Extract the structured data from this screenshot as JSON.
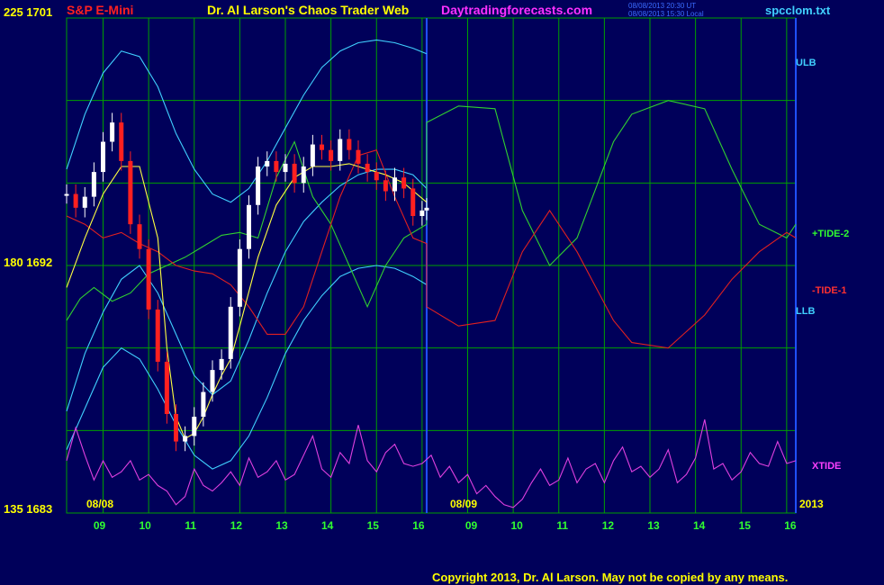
{
  "header": {
    "instrument": "S&P E-Mini",
    "title": "Dr. Al Larson's Chaos Trader Web",
    "site": "Daytradingforecasts.com",
    "stamp_line1": "08/08/2013 20:30 UT",
    "stamp_line2": "08/08/2013 15:30 Local",
    "file": "spcclom.txt"
  },
  "copyright": "Copyright 2013, Dr. Al Larson. May not be copied by any means.",
  "y_axis_labels": [
    "225 1701",
    "180 1692",
    "135 1683"
  ],
  "x_axis_labels": {
    "left_date": "08/08",
    "mid_date": "08/09",
    "year": "2013",
    "hours_day1": [
      "09",
      "10",
      "11",
      "12",
      "13",
      "14",
      "15",
      "16"
    ],
    "hours_day2": [
      "09",
      "10",
      "11",
      "12",
      "13",
      "14",
      "15",
      "16"
    ]
  },
  "series_labels": {
    "ulb": "ULB",
    "tide2": "+TIDE-2",
    "tide1": "-TIDE-1",
    "llb": "LLB",
    "xtide": "XTIDE"
  },
  "colors": {
    "background": "#00005a",
    "grid": "#00a000",
    "divider": "#2050ff",
    "price_up": "#ffffff",
    "price_down": "#ff2020",
    "band": "#40d0ff",
    "tide2": "#30d030",
    "tide1": "#e02020",
    "xtide": "#e040e0",
    "avg": "#ffff40"
  },
  "chart_data": {
    "type": "line",
    "y_left_range": [
      135,
      225
    ],
    "y_right_range": [
      1683,
      1701
    ],
    "x_range_hours": [
      8.2,
      24.2
    ],
    "divider_hour": 16.1,
    "series": [
      {
        "name": "ULB",
        "x": [
          8.2,
          8.6,
          9.0,
          9.4,
          9.8,
          10.2,
          10.6,
          11.0,
          11.4,
          11.8,
          12.2,
          12.6,
          13.0,
          13.4,
          13.8,
          14.2,
          14.6,
          15.0,
          15.4,
          15.8,
          16.1
        ],
        "y": [
          1695.5,
          1697.5,
          1699.0,
          1699.8,
          1699.6,
          1698.5,
          1696.8,
          1695.5,
          1694.6,
          1694.3,
          1694.8,
          1695.8,
          1697.0,
          1698.2,
          1699.2,
          1699.8,
          1700.1,
          1700.2,
          1700.1,
          1699.9,
          1699.7
        ]
      },
      {
        "name": "mid band",
        "x": [
          8.2,
          8.6,
          9.0,
          9.4,
          9.8,
          10.2,
          10.6,
          11.0,
          11.4,
          11.8,
          12.2,
          12.6,
          13.0,
          13.4,
          13.8,
          14.2,
          14.6,
          15.0,
          15.4,
          15.8,
          16.1
        ],
        "y": [
          1686.7,
          1688.8,
          1690.3,
          1691.5,
          1692.0,
          1691.0,
          1689.5,
          1688.0,
          1687.3,
          1687.8,
          1689.3,
          1691.0,
          1692.5,
          1693.6,
          1694.3,
          1694.9,
          1695.3,
          1695.5,
          1695.5,
          1695.3,
          1694.8
        ]
      },
      {
        "name": "LLB",
        "x": [
          8.2,
          8.6,
          9.0,
          9.4,
          9.8,
          10.2,
          10.6,
          11.0,
          11.4,
          11.8,
          12.2,
          12.6,
          13.0,
          13.4,
          13.8,
          14.2,
          14.6,
          15.0,
          15.4,
          15.8,
          16.1
        ],
        "y": [
          1685.3,
          1686.8,
          1688.3,
          1689.0,
          1688.6,
          1687.5,
          1686.2,
          1685.1,
          1684.6,
          1684.9,
          1685.8,
          1687.2,
          1688.8,
          1690.0,
          1690.9,
          1691.6,
          1691.9,
          1692.0,
          1691.9,
          1691.6,
          1691.3
        ]
      },
      {
        "name": "+TIDE-2",
        "x": [
          8.2,
          8.5,
          8.8,
          9.2,
          9.6,
          10.0,
          10.4,
          10.8,
          11.2,
          11.6,
          12.0,
          12.4,
          12.8,
          13.2,
          13.6,
          14.0,
          14.4,
          14.8,
          15.2,
          15.6,
          16.1,
          16.1,
          16.8,
          17.6,
          18.2,
          18.8,
          19.4,
          20.2,
          20.6,
          21.4,
          22.2,
          22.8,
          23.4,
          24.0,
          24.2
        ],
        "y": [
          1690.0,
          1690.8,
          1691.2,
          1690.7,
          1691.0,
          1691.7,
          1692.0,
          1692.3,
          1692.7,
          1693.1,
          1693.2,
          1693.0,
          1695.2,
          1696.5,
          1694.5,
          1693.5,
          1692.0,
          1690.5,
          1692.0,
          1693.0,
          1693.5,
          1697.2,
          1697.8,
          1697.7,
          1694.0,
          1692.0,
          1693.0,
          1696.5,
          1697.5,
          1698.0,
          1697.7,
          1695.5,
          1693.5,
          1693.0,
          1693.5
        ]
      },
      {
        "name": "-TIDE-1",
        "x": [
          8.2,
          8.6,
          9.0,
          9.4,
          9.8,
          10.2,
          10.6,
          11.0,
          11.4,
          11.8,
          12.2,
          12.6,
          13.0,
          13.4,
          13.8,
          14.2,
          14.6,
          15.0,
          15.4,
          15.8,
          16.1,
          16.1,
          16.8,
          17.6,
          18.2,
          18.8,
          19.4,
          20.2,
          20.6,
          21.4,
          22.2,
          22.8,
          23.4,
          24.0,
          24.2
        ],
        "y": [
          1693.8,
          1693.5,
          1693.0,
          1693.2,
          1692.8,
          1692.5,
          1692.0,
          1691.8,
          1691.7,
          1691.3,
          1690.5,
          1689.5,
          1689.5,
          1690.5,
          1692.5,
          1694.5,
          1696.0,
          1696.2,
          1694.5,
          1693.0,
          1692.8,
          1690.5,
          1689.8,
          1690.0,
          1692.5,
          1694.0,
          1692.5,
          1690.0,
          1689.2,
          1689.0,
          1690.2,
          1691.5,
          1692.5,
          1693.2,
          1693.0
        ]
      },
      {
        "name": "XTIDE",
        "x": [
          8.2,
          8.4,
          8.6,
          8.8,
          9.0,
          9.2,
          9.4,
          9.6,
          9.8,
          10.0,
          10.2,
          10.4,
          10.6,
          10.8,
          11.0,
          11.2,
          11.4,
          11.6,
          11.8,
          12.0,
          12.2,
          12.4,
          12.6,
          12.8,
          13.0,
          13.2,
          13.4,
          13.6,
          13.8,
          14.0,
          14.2,
          14.4,
          14.6,
          14.8,
          15.0,
          15.2,
          15.4,
          15.6,
          15.8,
          16.0,
          16.2,
          16.4,
          16.6,
          16.8,
          17.0,
          17.2,
          17.4,
          17.6,
          17.8,
          18.0,
          18.2,
          18.4,
          18.6,
          18.8,
          19.0,
          19.2,
          19.4,
          19.6,
          19.8,
          20.0,
          20.2,
          20.4,
          20.6,
          20.8,
          21.0,
          21.2,
          21.4,
          21.6,
          21.8,
          22.0,
          22.2,
          22.4,
          22.6,
          22.8,
          23.0,
          23.2,
          23.4,
          23.6,
          23.8,
          24.0,
          24.2
        ],
        "y": [
          1684.9,
          1686.1,
          1685.1,
          1684.2,
          1684.9,
          1684.3,
          1684.5,
          1684.9,
          1684.2,
          1684.4,
          1684.0,
          1683.8,
          1683.3,
          1683.6,
          1684.6,
          1684.0,
          1683.8,
          1684.1,
          1684.5,
          1684.0,
          1685.0,
          1684.3,
          1684.5,
          1684.9,
          1684.2,
          1684.4,
          1685.1,
          1685.8,
          1684.6,
          1684.3,
          1685.2,
          1684.8,
          1686.2,
          1684.9,
          1684.5,
          1685.2,
          1685.5,
          1684.8,
          1684.7,
          1684.8,
          1685.1,
          1684.3,
          1684.7,
          1684.1,
          1684.4,
          1683.7,
          1684.0,
          1683.6,
          1683.3,
          1683.2,
          1683.5,
          1684.1,
          1684.6,
          1684.0,
          1684.2,
          1685.0,
          1684.1,
          1684.6,
          1684.8,
          1684.1,
          1684.9,
          1685.4,
          1684.5,
          1684.7,
          1684.3,
          1684.6,
          1685.3,
          1684.1,
          1684.4,
          1685.0,
          1686.4,
          1684.6,
          1684.8,
          1684.2,
          1684.5,
          1685.2,
          1684.8,
          1684.7,
          1685.6,
          1684.8,
          1684.9
        ]
      },
      {
        "name": "moving average",
        "x": [
          8.2,
          8.6,
          9.0,
          9.4,
          9.8,
          10.2,
          10.4,
          10.6,
          10.8,
          11.0,
          11.2,
          11.4,
          11.6,
          11.8,
          12.0,
          12.4,
          12.8,
          13.2,
          13.6,
          14.0,
          14.4,
          14.8,
          15.2,
          15.6,
          16.1
        ],
        "y": [
          1691.2,
          1693.0,
          1694.6,
          1695.6,
          1695.6,
          1693.0,
          1689.0,
          1686.5,
          1685.7,
          1685.9,
          1686.5,
          1687.3,
          1688.0,
          1688.6,
          1689.8,
          1692.3,
          1694.2,
          1695.2,
          1695.6,
          1695.6,
          1695.7,
          1695.5,
          1695.3,
          1695.0,
          1694.3
        ]
      },
      {
        "name": "price closes",
        "x": [
          8.2,
          8.4,
          8.6,
          8.8,
          9.0,
          9.2,
          9.4,
          9.6,
          9.8,
          10.0,
          10.2,
          10.4,
          10.6,
          10.8,
          11.0,
          11.2,
          11.4,
          11.6,
          11.8,
          12.0,
          12.2,
          12.4,
          12.6,
          12.8,
          13.0,
          13.2,
          13.4,
          13.6,
          13.8,
          14.0,
          14.2,
          14.4,
          14.6,
          14.8,
          15.0,
          15.2,
          15.4,
          15.6,
          15.8,
          16.0,
          16.1
        ],
        "y": [
          1694.6,
          1694.1,
          1694.5,
          1695.4,
          1696.5,
          1697.2,
          1695.8,
          1693.5,
          1692.6,
          1690.4,
          1688.5,
          1686.6,
          1685.6,
          1685.8,
          1686.5,
          1687.4,
          1688.2,
          1688.6,
          1690.5,
          1692.6,
          1694.2,
          1695.6,
          1695.8,
          1695.4,
          1695.7,
          1695.0,
          1695.6,
          1696.4,
          1696.2,
          1695.8,
          1696.6,
          1696.2,
          1695.7,
          1695.4,
          1695.1,
          1694.7,
          1695.2,
          1694.8,
          1693.8,
          1694.0,
          1694.1
        ]
      }
    ]
  }
}
